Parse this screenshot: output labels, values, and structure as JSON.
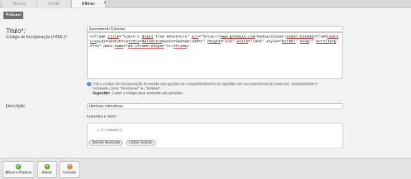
{
  "tabs": [
    {
      "label": "Buscar"
    },
    {
      "label": "Incluir"
    },
    {
      "label": "Alterar"
    }
  ],
  "close_glyph": "×",
  "section_badge": "Podcast",
  "form": {
    "titulo_label": "Titulo*:",
    "titulo_value": "Aprendendo Ciências",
    "codigo_label": "Código de Incorporação (HTML)*:",
    "codigo_parts": [
      "<iframe ",
      "title",
      "=\"Simon's ",
      "Brain",
      " Tree Adventure\" ",
      "src",
      "=\"https://",
      "www.podbean.com",
      "/media/player/",
      "vs847-e36e40",
      "?from=",
      "usersite",
      "&vjs=1&skin=1&",
      "fonts",
      "=",
      "Helvetica",
      "&auto=0&download=1\" ",
      "height",
      "=\"315\" ",
      "width",
      "=\"100%\" style=\"",
      "border",
      ": ",
      "none",
      ";\" ",
      "scrolling",
      "=\"no\" data-",
      "name",
      "=\"",
      "pb-iframe-player",
      "\"></",
      "iframe",
      ">"
    ],
    "help_line1": "Use o código de incorporação fornecido nas opções de compartilhamento do episódio em sua plataforma de podcasts. Normalmente é",
    "help_line2": "nomeado como \"Incorporar\" ou \"Embed\".",
    "help_suggest_label": "Sugestão:",
    "help_suggest_text": " Copie o código para somente um episódio.",
    "descricao_label": "Descrição:",
    "descricao_value": "Histórias educativas",
    "units_title": "Unidades e Sites*",
    "units_count": "1 unidade(s)",
    "btn_advanced": "Seleção Avançada",
    "btn_clear": "Limpar Seleção"
  },
  "footer": {
    "save_publish": "Alterar e Publicar",
    "save": "Alterar",
    "cancel": "Cancelar"
  },
  "icons": {
    "check": "✓",
    "plus": "+",
    "minus": "−",
    "info": "i"
  }
}
